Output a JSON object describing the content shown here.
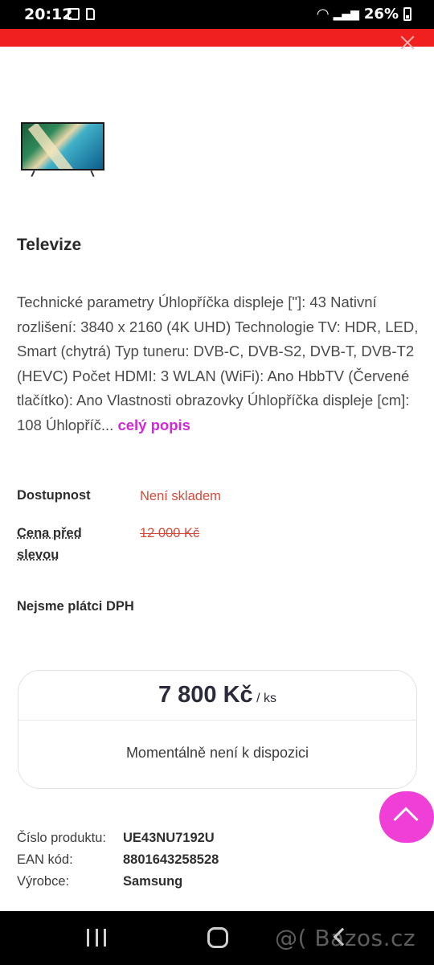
{
  "status_bar": {
    "time": "20:12",
    "battery": "26%"
  },
  "product": {
    "title": "Televize",
    "description": "Technické parametry Úhlopříčka displeje [\"]: 43 Nativní rozlišení: 3840 x 2160 (4K UHD) Technologie TV: HDR, LED, Smart (chytrá) Typ tuneru: DVB-C, DVB-S2, DVB-T, DVB-T2 (HEVC) Počet HDMI: 3 WLAN (WiFi): Ano HbbTV (Červené tlačítko): Ano Vlastnosti obrazovky Úhlopříčka displeje [cm]: 108 Úhlopříč...",
    "more_link": "celý popis"
  },
  "info": {
    "availability_label": "Dostupnost",
    "availability_value": "Není skladem",
    "old_price_label": "Cena před slevou",
    "old_price_value": "12 000 Kč",
    "vat_note": "Nejsme plátci DPH"
  },
  "price_box": {
    "price": "7 800 Kč",
    "unit": "/ ks",
    "availability_message": "Momentálně není k dispozici"
  },
  "specs": [
    {
      "label": "Číslo produktu:",
      "value": "UE43NU7192U"
    },
    {
      "label": "EAN kód:",
      "value": "8801643258528"
    },
    {
      "label": "Výrobce:",
      "value": "Samsung"
    }
  ],
  "watermark": "@( Bazos.cz",
  "colors": {
    "top_bar": "#f02020",
    "accent_link": "#d02ad8",
    "scroll_button": "#f03fd6",
    "unavailable_text": "#d44a3a"
  }
}
